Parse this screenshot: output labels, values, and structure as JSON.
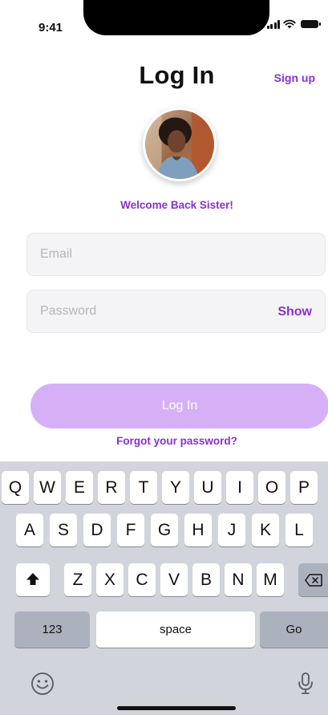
{
  "status_bar": {
    "time": "9:41",
    "icons": [
      "signal-icon",
      "wifi-icon",
      "battery-icon"
    ]
  },
  "header": {
    "title": "Log In",
    "signup_label": "Sign up"
  },
  "profile": {
    "welcome_text": "Welcome Back Sister!"
  },
  "form": {
    "email": {
      "placeholder": "Email",
      "value": ""
    },
    "password": {
      "placeholder": "Password",
      "value": "",
      "toggle_label": "Show"
    },
    "submit_label": "Log In",
    "forgot_label": "Forgot your password?"
  },
  "keyboard": {
    "row1": [
      "Q",
      "W",
      "E",
      "R",
      "T",
      "Y",
      "U",
      "I",
      "O",
      "P"
    ],
    "row2": [
      "A",
      "S",
      "D",
      "F",
      "G",
      "H",
      "J",
      "K",
      "L"
    ],
    "row3": [
      "Z",
      "X",
      "C",
      "V",
      "B",
      "N",
      "M"
    ],
    "numbers_label": "123",
    "space_label": "space",
    "go_label": "Go",
    "shift_icon": "shift-icon",
    "backspace_icon": "backspace-icon",
    "emoji_icon": "emoji-icon",
    "mic_icon": "microphone-icon"
  },
  "colors": {
    "accent": "#8b2fd1",
    "button_fill": "#d6b0f6",
    "input_fill": "#f4f4f6",
    "keyboard_bg": "#d1d4db"
  }
}
